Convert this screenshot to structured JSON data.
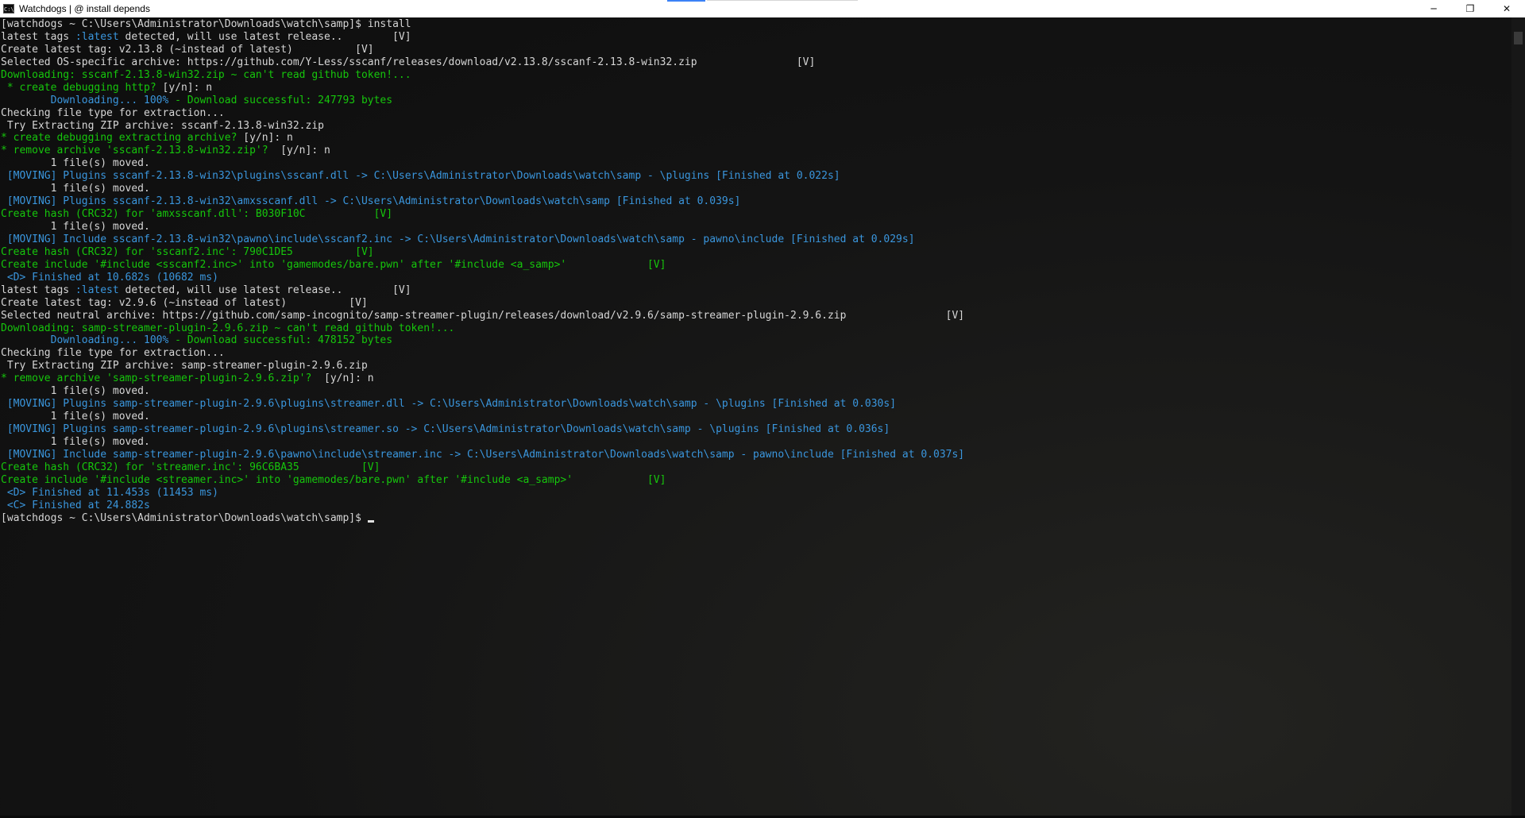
{
  "window": {
    "title": "Watchdogs | @ install depends",
    "icon_text": "C:\\",
    "controls": {
      "minimize": "─",
      "maximize": "❐",
      "close": "✕"
    }
  },
  "console": {
    "lines": [
      [
        [
          "w",
          "[watchdogs ~ C:\\Users\\Administrator\\Downloads\\watch\\samp]$ install"
        ]
      ],
      [
        [
          "w",
          "latest tags "
        ],
        [
          "b",
          ":latest"
        ],
        [
          "w",
          " detected, will use latest release..        [V]"
        ]
      ],
      [
        [
          "w",
          "Create latest tag: v2.13.8 (~instead of latest)          [V]"
        ]
      ],
      [
        [
          "w",
          "Selected OS-specific archive: https://github.com/Y-Less/sscanf/releases/download/v2.13.8/sscanf-2.13.8-win32.zip                [V]"
        ]
      ],
      [
        [
          "g",
          "Downloading: sscanf-2.13.8-win32.zip ~ can't read github token!..."
        ]
      ],
      [
        [
          "g",
          " * create debugging http? "
        ],
        [
          "w",
          "[y/n]: n"
        ]
      ],
      [
        [
          "b",
          "        Downloading... 100% "
        ],
        [
          "g",
          "- Download successful: 247793 bytes"
        ]
      ],
      [
        [
          "w",
          "Checking file type for extraction..."
        ]
      ],
      [
        [
          "w",
          " Try Extracting ZIP archive: sscanf-2.13.8-win32.zip"
        ]
      ],
      [
        [
          "g",
          "* create debugging extracting archive? "
        ],
        [
          "w",
          "[y/n]: n"
        ]
      ],
      [
        [
          "g",
          "* remove archive 'sscanf-2.13.8-win32.zip'?  "
        ],
        [
          "w",
          "[y/n]: n"
        ]
      ],
      [
        [
          "w",
          "        1 file(s) moved."
        ]
      ],
      [
        [
          "b",
          " [MOVING] Plugins sscanf-2.13.8-win32\\plugins\\sscanf.dll -> C:\\Users\\Administrator\\Downloads\\watch\\samp - \\plugins [Finished at 0.022s]"
        ]
      ],
      [
        [
          "w",
          "        1 file(s) moved."
        ]
      ],
      [
        [
          "b",
          " [MOVING] Plugins sscanf-2.13.8-win32\\amxsscanf.dll -> C:\\Users\\Administrator\\Downloads\\watch\\samp [Finished at 0.039s]"
        ]
      ],
      [
        [
          "g",
          "Create hash (CRC32) for 'amxsscanf.dll': B030F10C           [V]"
        ]
      ],
      [
        [
          "w",
          "        1 file(s) moved."
        ]
      ],
      [
        [
          "b",
          " [MOVING] Include sscanf-2.13.8-win32\\pawno\\include\\sscanf2.inc -> C:\\Users\\Administrator\\Downloads\\watch\\samp - pawno\\include [Finished at 0.029s]"
        ]
      ],
      [
        [
          "g",
          "Create hash (CRC32) for 'sscanf2.inc': 790C1DE5          [V]"
        ]
      ],
      [
        [
          "g",
          "Create include '#include <sscanf2.inc>' into 'gamemodes/bare.pwn' after '#include <a_samp>'             [V]"
        ]
      ],
      [
        [
          "b",
          " <D> Finished at 10.682s (10682 ms)"
        ]
      ],
      [
        [
          "w",
          "latest tags "
        ],
        [
          "b",
          ":latest"
        ],
        [
          "w",
          " detected, will use latest release..        [V]"
        ]
      ],
      [
        [
          "w",
          "Create latest tag: v2.9.6 (~instead of latest)          [V]"
        ]
      ],
      [
        [
          "w",
          "Selected neutral archive: https://github.com/samp-incognito/samp-streamer-plugin/releases/download/v2.9.6/samp-streamer-plugin-2.9.6.zip                [V]"
        ]
      ],
      [
        [
          "g",
          "Downloading: samp-streamer-plugin-2.9.6.zip ~ can't read github token!..."
        ]
      ],
      [
        [
          "b",
          "        Downloading... 100% "
        ],
        [
          "g",
          "- Download successful: 478152 bytes"
        ]
      ],
      [
        [
          "w",
          "Checking file type for extraction..."
        ]
      ],
      [
        [
          "w",
          " Try Extracting ZIP archive: samp-streamer-plugin-2.9.6.zip"
        ]
      ],
      [
        [
          "g",
          "* remove archive 'samp-streamer-plugin-2.9.6.zip'?  "
        ],
        [
          "w",
          "[y/n]: n"
        ]
      ],
      [
        [
          "w",
          "        1 file(s) moved."
        ]
      ],
      [
        [
          "b",
          " [MOVING] Plugins samp-streamer-plugin-2.9.6\\plugins\\streamer.dll -> C:\\Users\\Administrator\\Downloads\\watch\\samp - \\plugins [Finished at 0.030s]"
        ]
      ],
      [
        [
          "w",
          "        1 file(s) moved."
        ]
      ],
      [
        [
          "b",
          " [MOVING] Plugins samp-streamer-plugin-2.9.6\\plugins\\streamer.so -> C:\\Users\\Administrator\\Downloads\\watch\\samp - \\plugins [Finished at 0.036s]"
        ]
      ],
      [
        [
          "w",
          "        1 file(s) moved."
        ]
      ],
      [
        [
          "b",
          " [MOVING] Include samp-streamer-plugin-2.9.6\\pawno\\include\\streamer.inc -> C:\\Users\\Administrator\\Downloads\\watch\\samp - pawno\\include [Finished at 0.037s]"
        ]
      ],
      [
        [
          "g",
          "Create hash (CRC32) for 'streamer.inc': 96C6BA35          [V]"
        ]
      ],
      [
        [
          "g",
          "Create include '#include <streamer.inc>' into 'gamemodes/bare.pwn' after '#include <a_samp>'            [V]"
        ]
      ],
      [
        [
          "b",
          " <D> Finished at 11.453s (11453 ms)"
        ]
      ],
      [
        [
          "b",
          " <C> Finished at 24.882s"
        ]
      ]
    ],
    "prompt": "[watchdogs ~ C:\\Users\\Administrator\\Downloads\\watch\\samp]$ "
  }
}
